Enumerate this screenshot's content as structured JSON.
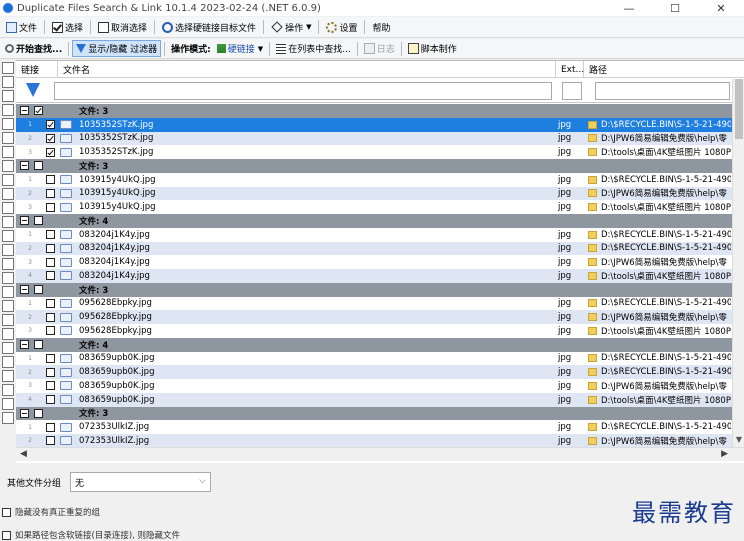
{
  "window": {
    "title": "Duplicate Files Search & Link 10.1.4 2023-02-24 (.NET 6.0.9)",
    "minimize": "—",
    "maximize": "☐",
    "close": "✕"
  },
  "menu": {
    "file": "文件",
    "select": "选择",
    "deselect": "取消选择",
    "select_target": "选择硬链接目标文件",
    "operation": "操作",
    "settings": "设置",
    "help": "帮助"
  },
  "toolbar": {
    "start_search": "开始查找...",
    "toggle_filter": "显示/隐藏 过滤器",
    "op_mode_label": "操作模式:",
    "hardlink": "硬链接",
    "find_in_list": "在列表中查找...",
    "log": "日志",
    "script": "脚本制作"
  },
  "columns": {
    "link": "链接",
    "filename": "文件名",
    "ext": "Ext...",
    "path": "路径"
  },
  "groups": [
    {
      "title": "文件: 3",
      "checked": true,
      "files": [
        {
          "num": "1",
          "name": "1035352STzK.jpg",
          "ext": "jpg",
          "path": "D:\\$RECYCLE.BIN\\S-1-5-21-4909",
          "checked": true,
          "selected": true
        },
        {
          "num": "2",
          "name": "1035352STzK.jpg",
          "ext": "jpg",
          "path": "D:\\JPW6简易编辑免费版\\help\\零",
          "checked": true,
          "selected": false
        },
        {
          "num": "3",
          "name": "1035352STzK.jpg",
          "ext": "jpg",
          "path": "D:\\tools\\桌面\\4K壁纸图片 1080P",
          "checked": true,
          "selected": false
        }
      ]
    },
    {
      "title": "文件: 3",
      "checked": false,
      "files": [
        {
          "num": "1",
          "name": "103915y4UkQ.jpg",
          "ext": "jpg",
          "path": "D:\\$RECYCLE.BIN\\S-1-5-21-4909",
          "checked": false,
          "selected": false
        },
        {
          "num": "2",
          "name": "103915y4UkQ.jpg",
          "ext": "jpg",
          "path": "D:\\JPW6简易编辑免费版\\help\\零",
          "checked": false,
          "selected": false
        },
        {
          "num": "3",
          "name": "103915y4UkQ.jpg",
          "ext": "jpg",
          "path": "D:\\tools\\桌面\\4K壁纸图片 1080P",
          "checked": false,
          "selected": false
        }
      ]
    },
    {
      "title": "文件: 4",
      "checked": false,
      "files": [
        {
          "num": "1",
          "name": "083204j1K4y.jpg",
          "ext": "jpg",
          "path": "D:\\$RECYCLE.BIN\\S-1-5-21-4909",
          "checked": false,
          "selected": false
        },
        {
          "num": "2",
          "name": "083204j1K4y.jpg",
          "ext": "jpg",
          "path": "D:\\$RECYCLE.BIN\\S-1-5-21-4909",
          "checked": false,
          "selected": false
        },
        {
          "num": "3",
          "name": "083204j1K4y.jpg",
          "ext": "jpg",
          "path": "D:\\JPW6简易编辑免费版\\help\\零",
          "checked": false,
          "selected": false
        },
        {
          "num": "4",
          "name": "083204j1K4y.jpg",
          "ext": "jpg",
          "path": "D:\\tools\\桌面\\4K壁纸图片 1080P",
          "checked": false,
          "selected": false
        }
      ]
    },
    {
      "title": "文件: 3",
      "checked": false,
      "files": [
        {
          "num": "1",
          "name": "095628Ebpky.jpg",
          "ext": "jpg",
          "path": "D:\\$RECYCLE.BIN\\S-1-5-21-4909",
          "checked": false,
          "selected": false
        },
        {
          "num": "2",
          "name": "095628Ebpky.jpg",
          "ext": "jpg",
          "path": "D:\\JPW6简易编辑免费版\\help\\零",
          "checked": false,
          "selected": false
        },
        {
          "num": "3",
          "name": "095628Ebpky.jpg",
          "ext": "jpg",
          "path": "D:\\tools\\桌面\\4K壁纸图片 1080P",
          "checked": false,
          "selected": false
        }
      ]
    },
    {
      "title": "文件: 4",
      "checked": false,
      "files": [
        {
          "num": "1",
          "name": "083659upb0K.jpg",
          "ext": "jpg",
          "path": "D:\\$RECYCLE.BIN\\S-1-5-21-4909",
          "checked": false,
          "selected": false
        },
        {
          "num": "2",
          "name": "083659upb0K.jpg",
          "ext": "jpg",
          "path": "D:\\$RECYCLE.BIN\\S-1-5-21-4909",
          "checked": false,
          "selected": false
        },
        {
          "num": "3",
          "name": "083659upb0K.jpg",
          "ext": "jpg",
          "path": "D:\\JPW6简易编辑免费版\\help\\零",
          "checked": false,
          "selected": false
        },
        {
          "num": "4",
          "name": "083659upb0K.jpg",
          "ext": "jpg",
          "path": "D:\\tools\\桌面\\4K壁纸图片 1080P",
          "checked": false,
          "selected": false
        }
      ]
    },
    {
      "title": "文件: 3",
      "checked": false,
      "files": [
        {
          "num": "1",
          "name": "072353UlkIZ.jpg",
          "ext": "jpg",
          "path": "D:\\$RECYCLE.BIN\\S-1-5-21-4909",
          "checked": false,
          "selected": false
        },
        {
          "num": "2",
          "name": "072353UlkIZ.jpg",
          "ext": "jpg",
          "path": "D:\\JPW6简易编辑免费版\\help\\零",
          "checked": false,
          "selected": false
        }
      ]
    }
  ],
  "bottom": {
    "group_label": "其他文件分组",
    "group_value": "无",
    "opt_hide_no_dup": "隐藏没有真正重复的组",
    "opt_hide_softlink": "如果路径包含软链接(目录连接), 则隐藏文件",
    "watermark": "最需教育"
  },
  "colors": {
    "selected_row": "#1f7fe0",
    "group_row": "#8e96a0",
    "alt_row": "#dfe6f3",
    "watermark": "#1a3b8f"
  }
}
